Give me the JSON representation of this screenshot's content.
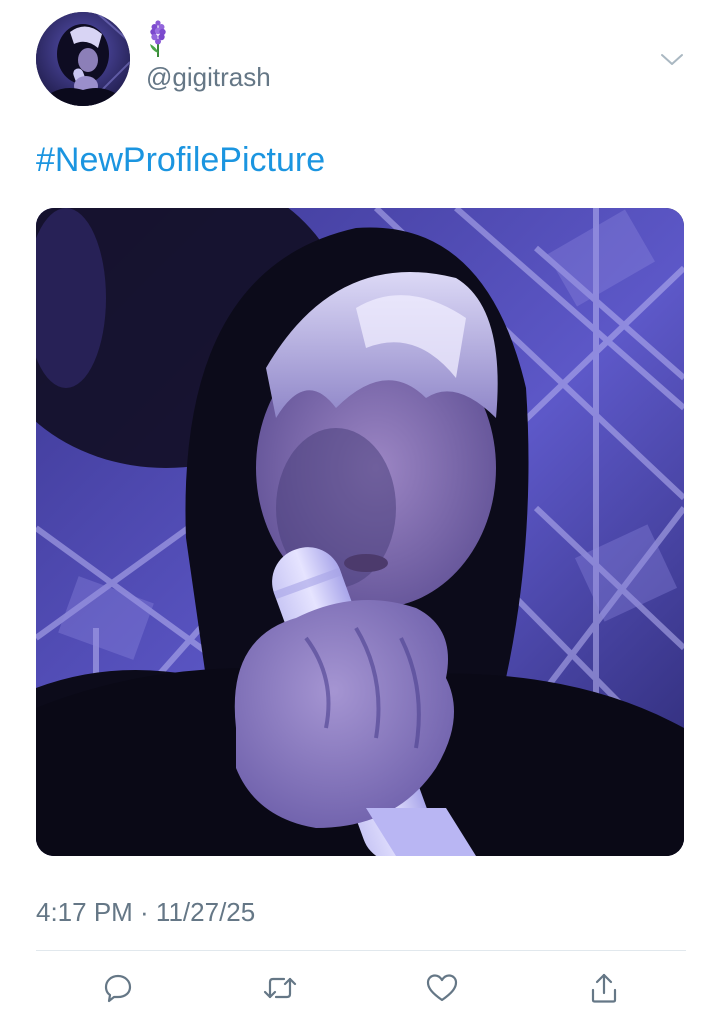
{
  "tweet": {
    "display_name_emoji": "🪻",
    "handle": "@gigitrash",
    "hashtag": "#NewProfilePicture",
    "timestamp": "4:17 PM · 11/27/25"
  },
  "icons": {
    "menu": "chevron-down-icon",
    "reply": "speech-bubble-icon",
    "retweet": "retweet-arrows-icon",
    "like": "heart-icon",
    "share": "share-upload-icon"
  },
  "colors": {
    "link": "#1b95e0",
    "secondary_text": "#657786",
    "icon": "#657786",
    "divider": "#e1e8ed"
  }
}
